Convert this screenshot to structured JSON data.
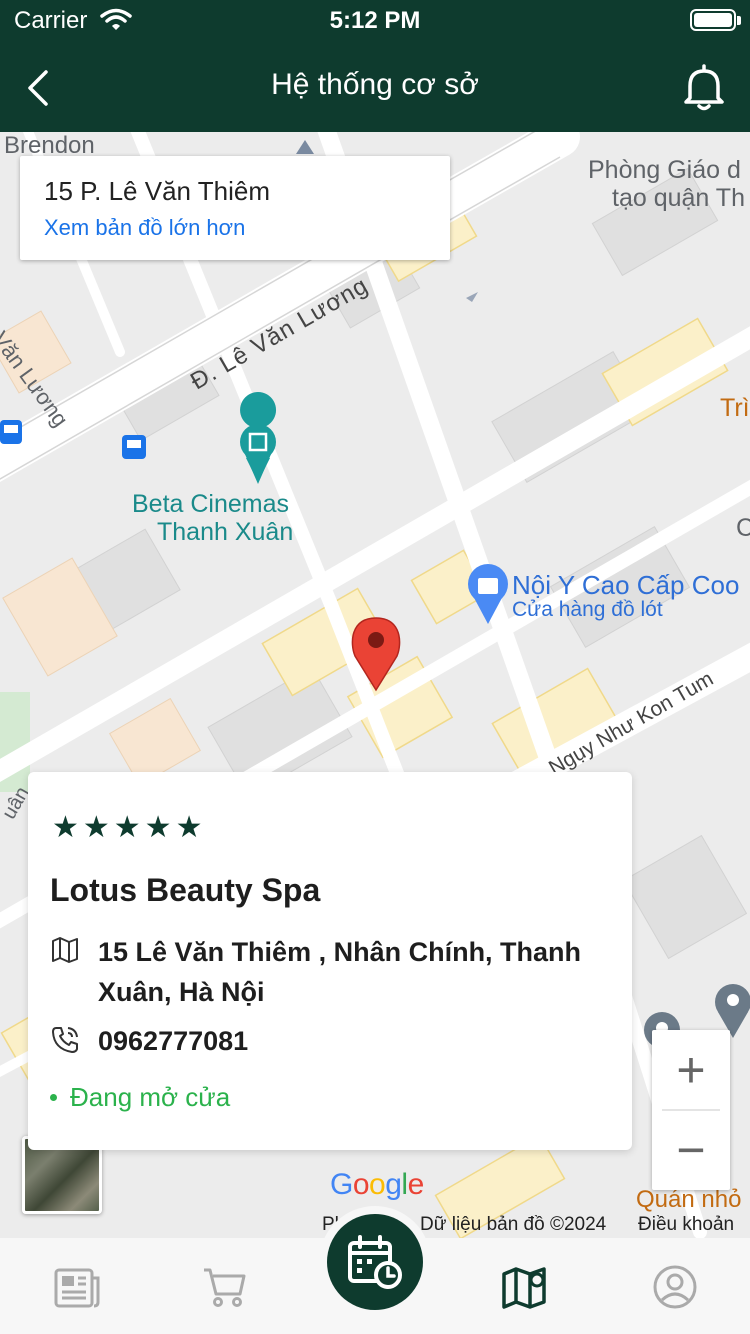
{
  "status_bar": {
    "carrier": "Carrier",
    "time": "5:12 PM"
  },
  "header": {
    "title": "Hệ thống cơ sở",
    "back_icon": "chevron-left-icon",
    "notification_icon": "bell-icon"
  },
  "map": {
    "address_card": {
      "title": "15 P. Lê Văn Thiêm",
      "link": "Xem bản đồ lớn hơn"
    },
    "labels": {
      "brendon": "Brendon",
      "phong_giao_1": "Phòng Giáo d",
      "phong_giao_2": "tạo quận Th",
      "le_van_luong_left": "Lê Văn Lương",
      "le_van_luong_road": "Đ. Lê Văn Lương",
      "tri": "Trì",
      "beta_1": "Beta Cinemas",
      "beta_2": "Thanh Xuân",
      "c": "C",
      "noi_y": "Nội Y Cao Cấp Coo",
      "cua_hang": "Cửa hàng đồ lót",
      "nguy_nhu": "Ngụy Như Kon Tum",
      "uan": "uân",
      "quan_nho": "Quán nhỏ"
    },
    "zoom_in": "+",
    "zoom_out": "−",
    "google_logo": "Google",
    "attribution_left": "Phí",
    "attribution": "Dữ liệu bản đồ ©2024",
    "terms": "Điều khoản"
  },
  "place": {
    "rating": "★★★★★",
    "name": "Lotus Beauty Spa",
    "address": "15 Lê Văn Thiêm , Nhân Chính, Thanh Xuân, Hà Nội",
    "phone": "0962777081",
    "status": "Đang mở cửa"
  },
  "bottom_nav": {
    "items": [
      "news-icon",
      "cart-icon",
      "booking-calendar-icon",
      "map-icon",
      "profile-icon"
    ],
    "active": "map-icon"
  },
  "colors": {
    "primary": "#0e3b2e",
    "link": "#1a73e8",
    "open": "#2bb24c",
    "pin": "#ea4335",
    "poi_teal": "#1a8a8a"
  }
}
